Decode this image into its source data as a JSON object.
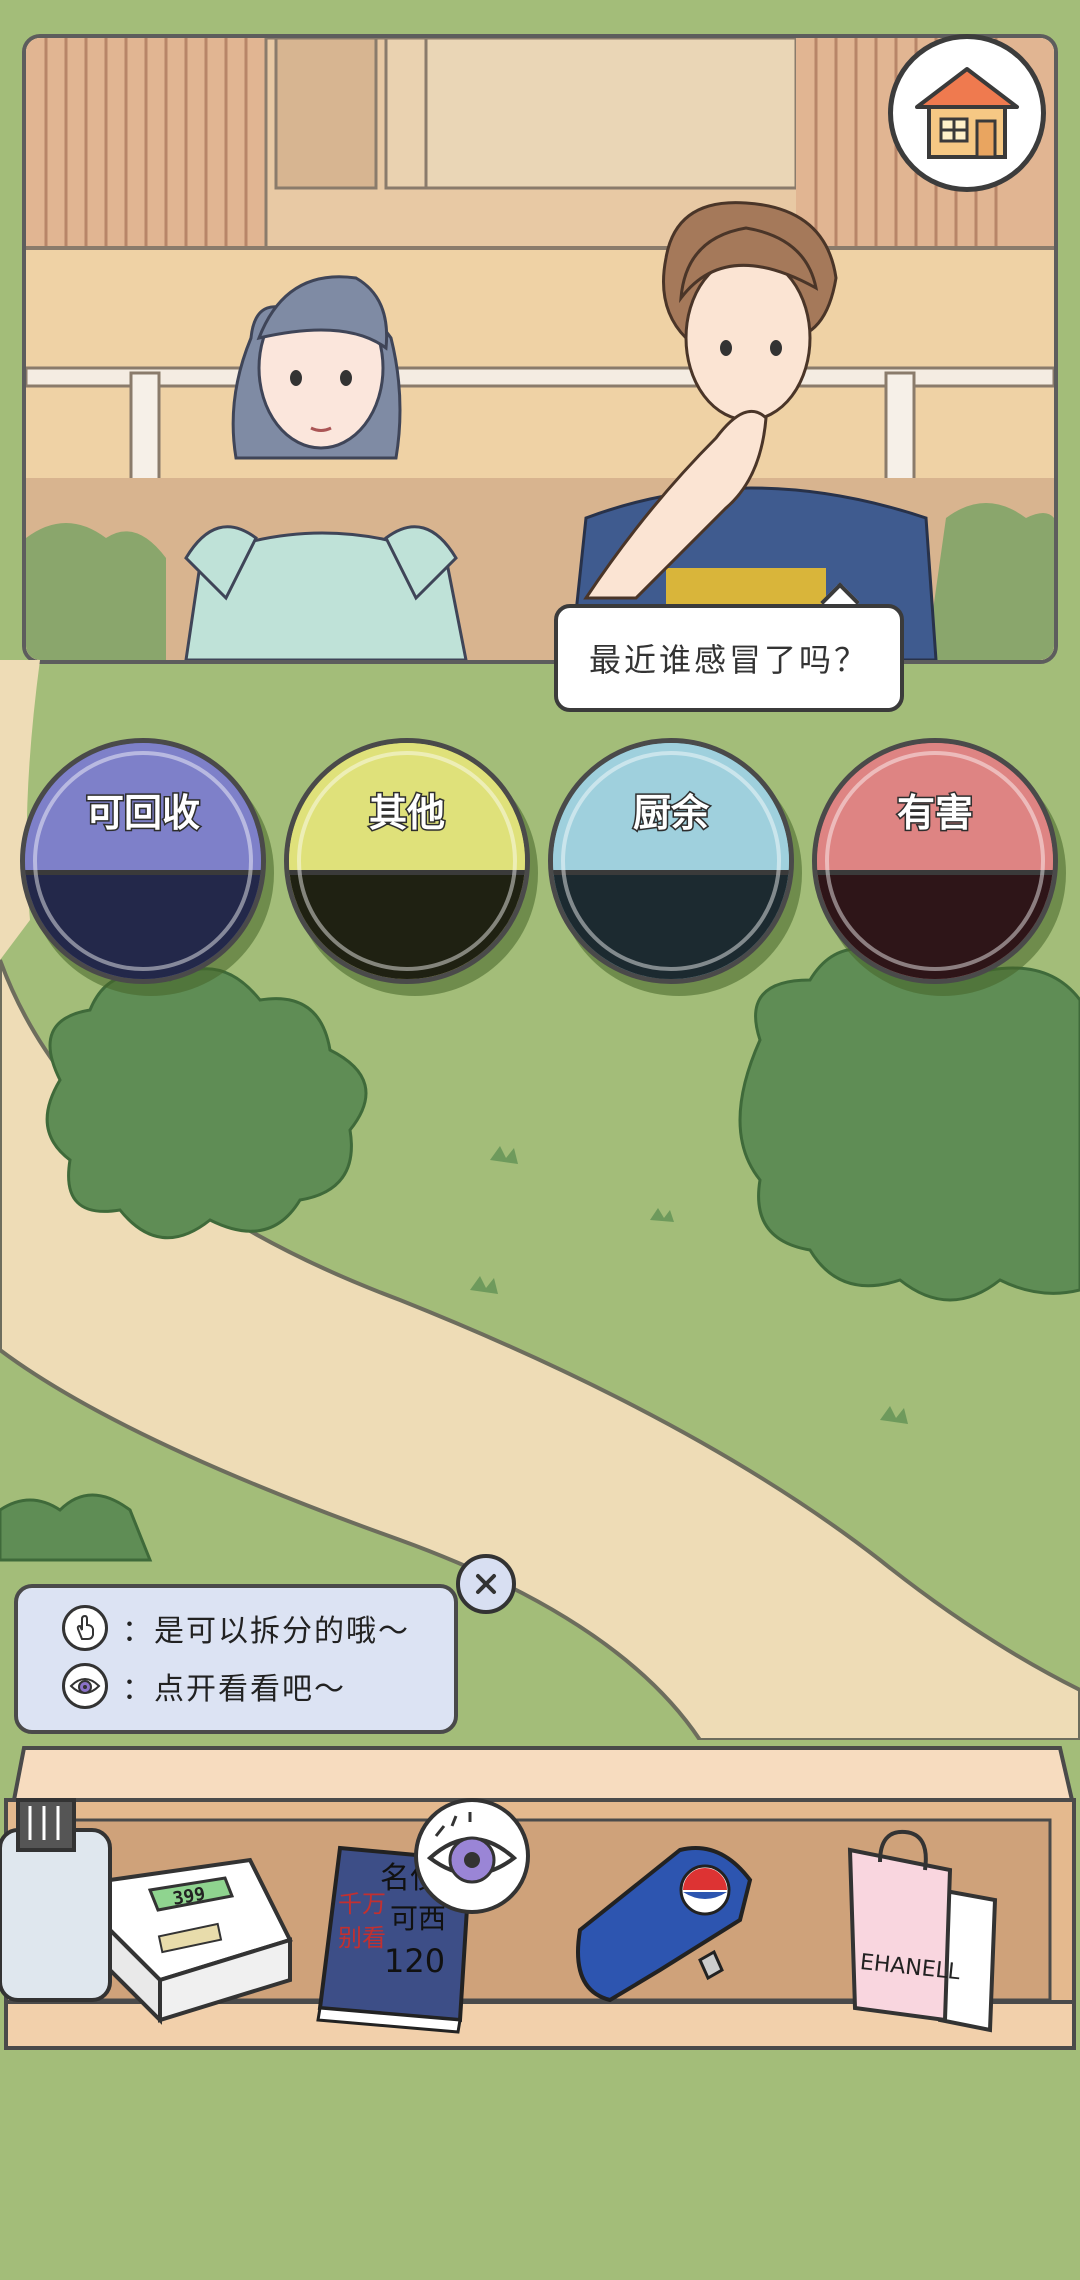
{
  "speech": {
    "text": "最近谁感冒了吗？"
  },
  "bins": [
    {
      "label": "可回收",
      "top_color": "#7e80c9",
      "bottom_color": "#23284a",
      "ring_color": "#5b5eaa"
    },
    {
      "label": "其他",
      "top_color": "#dfe17a",
      "bottom_color": "#1f2112",
      "ring_color": "#c8c95b"
    },
    {
      "label": "厨余",
      "top_color": "#9fd0dd",
      "bottom_color": "#1c2a30",
      "ring_color": "#76b6c7"
    },
    {
      "label": "有害",
      "top_color": "#de8483",
      "bottom_color": "#2e1518",
      "ring_color": "#c86668"
    }
  ],
  "hint": {
    "lines": [
      {
        "icon": "hand-tap-icon",
        "text": "：是可以拆分的哦～"
      },
      {
        "icon": "eye-icon",
        "text": "：点开看看吧～"
      }
    ]
  },
  "items": {
    "glucometer_display": "399",
    "book_text": [
      "名侦",
      "可西",
      "千万",
      "别看",
      "120"
    ],
    "bag_brand": "EHANELL"
  },
  "colors": {
    "background": "#a3bd79",
    "path": "#eedcb6",
    "tree": "#5f8d55",
    "shelf": "#f5d8b8"
  }
}
